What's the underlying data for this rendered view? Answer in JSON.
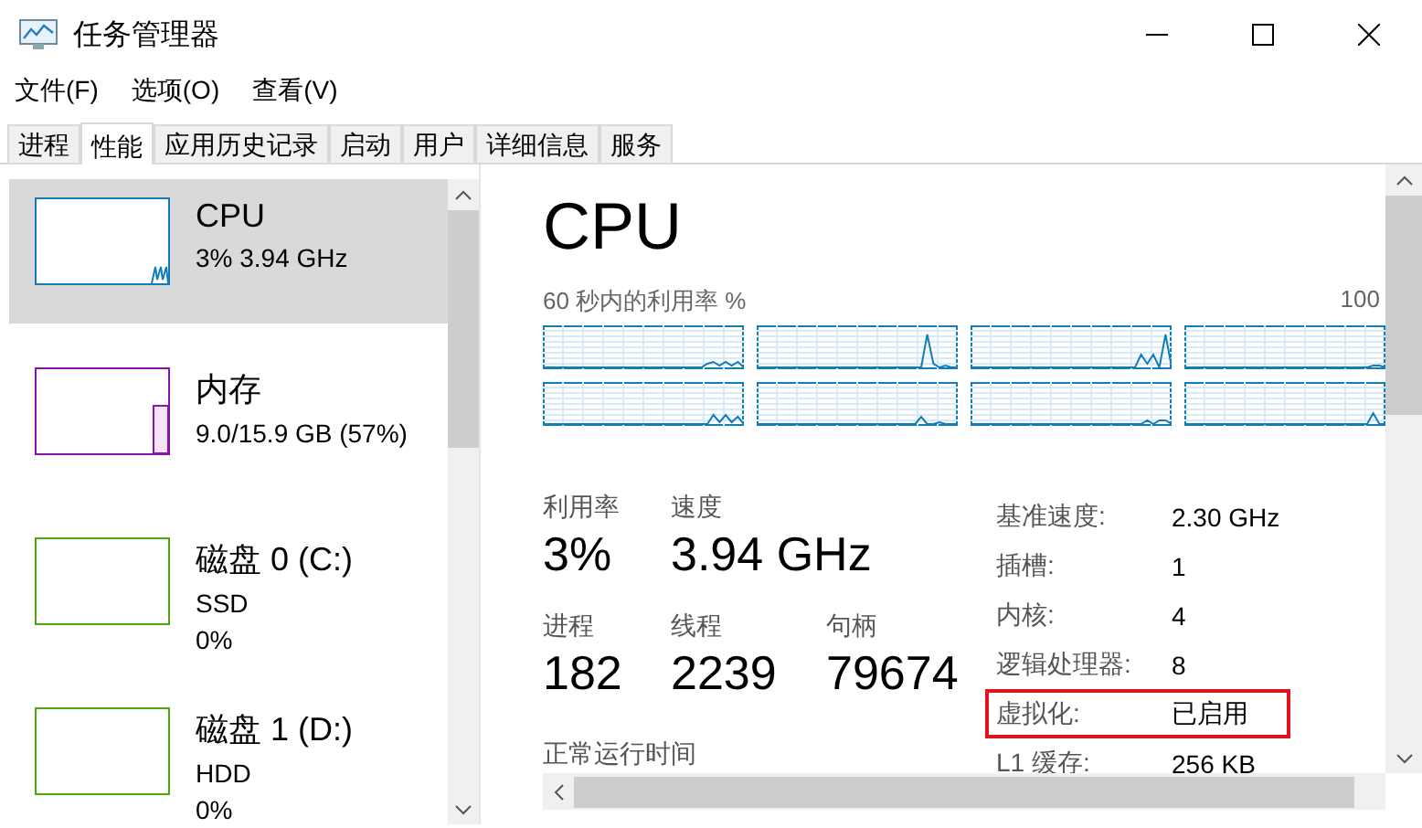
{
  "window": {
    "title": "任务管理器"
  },
  "menu": [
    "文件(F)",
    "选项(O)",
    "查看(V)"
  ],
  "tabs": [
    {
      "label": "进程",
      "selected": false
    },
    {
      "label": "性能",
      "selected": true
    },
    {
      "label": "应用历史记录",
      "selected": false
    },
    {
      "label": "启动",
      "selected": false
    },
    {
      "label": "用户",
      "selected": false
    },
    {
      "label": "详细信息",
      "selected": false
    },
    {
      "label": "服务",
      "selected": false
    }
  ],
  "sidebar": {
    "items": [
      {
        "name": "CPU",
        "lines": [
          "3% 3.94 GHz"
        ],
        "color": "#117dbb",
        "selected": true
      },
      {
        "name": "内存",
        "lines": [
          "9.0/15.9 GB (57%)"
        ],
        "color": "#8b12ae",
        "selected": false
      },
      {
        "name": "磁盘 0 (C:)",
        "lines": [
          "SSD",
          "0%"
        ],
        "color": "#4da60c",
        "selected": false
      },
      {
        "name": "磁盘 1 (D:)",
        "lines": [
          "HDD",
          "0%"
        ],
        "color": "#4da60c",
        "selected": false
      }
    ]
  },
  "detail": {
    "title": "CPU",
    "graph_label": "60 秒内的利用率 %",
    "graph_max": "100",
    "stats": [
      {
        "label": "利用率",
        "value": "3%"
      },
      {
        "label": "速度",
        "value": "3.94 GHz"
      },
      {
        "label": "进程",
        "value": "182"
      },
      {
        "label": "线程",
        "value": "2239"
      },
      {
        "label": "句柄",
        "value": "79674"
      }
    ],
    "uptime_label": "正常运行时间",
    "specs": [
      {
        "label": "基准速度:",
        "value": "2.30 GHz",
        "highlighted": false
      },
      {
        "label": "插槽:",
        "value": "1",
        "highlighted": false
      },
      {
        "label": "内核:",
        "value": "4",
        "highlighted": false
      },
      {
        "label": "逻辑处理器:",
        "value": "8",
        "highlighted": false
      },
      {
        "label": "虚拟化:",
        "value": "已启用",
        "highlighted": true
      },
      {
        "label": "L1 缓存:",
        "value": "256 KB",
        "highlighted": false
      }
    ]
  }
}
